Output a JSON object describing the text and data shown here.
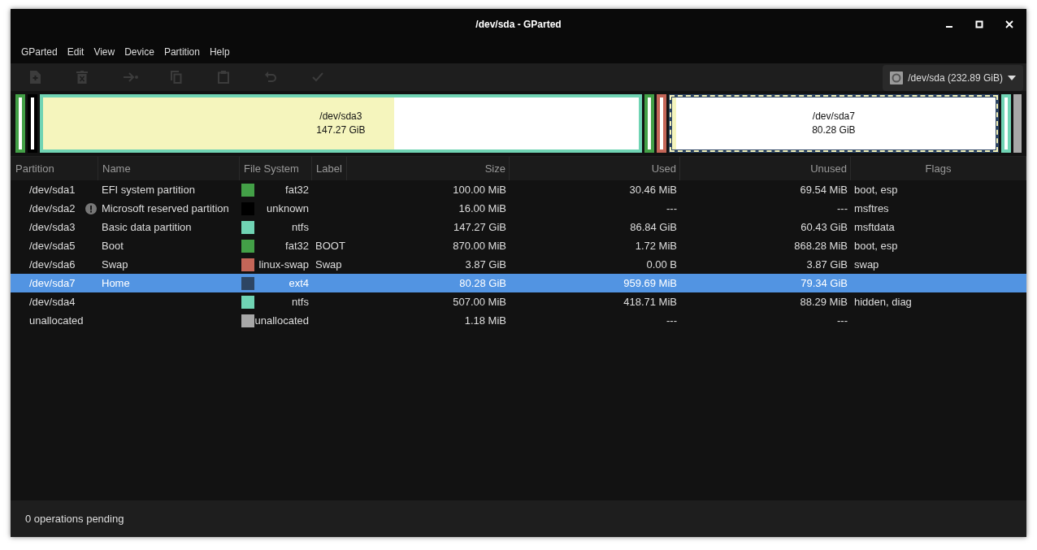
{
  "window": {
    "title": "/dev/sda - GParted"
  },
  "menu": [
    "GParted",
    "Edit",
    "View",
    "Device",
    "Partition",
    "Help"
  ],
  "toolbar": [
    {
      "kind": "new",
      "disabled": true
    },
    {
      "kind": "delete",
      "disabled": true
    },
    {
      "kind": "resize",
      "disabled": true
    },
    {
      "kind": "copy",
      "disabled": true
    },
    {
      "kind": "paste",
      "disabled": true
    },
    {
      "kind": "undo",
      "disabled": true
    },
    {
      "kind": "apply",
      "disabled": true
    }
  ],
  "device": {
    "label": "/dev/sda (232.89 GiB)"
  },
  "map": [
    {
      "kind": "narrow",
      "color": "#43a047",
      "selected": false
    },
    {
      "kind": "narrow",
      "color": "#000000",
      "selected": false
    },
    {
      "kind": "wide",
      "color": "#70d4b4",
      "level": 0.59,
      "name": "/dev/sda3",
      "size": "147.27 GiB",
      "selected": false
    },
    {
      "kind": "narrow",
      "color": "#43a047",
      "selected": false
    },
    {
      "kind": "narrow",
      "color": "#c46658",
      "selected": false
    },
    {
      "kind": "wide",
      "color": "#2d4563",
      "level": 0.012,
      "name": "/dev/sda7",
      "size": "80.28 GiB",
      "selected": true
    },
    {
      "kind": "narrow",
      "color": "#70d4b4",
      "selected": false
    },
    {
      "kind": "unallocated",
      "color": "#a8a8a8",
      "selected": false
    }
  ],
  "table": {
    "columns": [
      "Partition",
      "Name",
      "File System",
      "Label",
      "Size",
      "Used",
      "Unused",
      "Flags"
    ],
    "rows": [
      {
        "partition": "/dev/sda1",
        "warning": false,
        "name": "EFI system partition",
        "color": "#43a047",
        "file_system": "fat32",
        "label": "",
        "size": "100.00 MiB",
        "used": "30.46 MiB",
        "unused": "69.54 MiB",
        "flags": "boot, esp",
        "selected": false
      },
      {
        "partition": "/dev/sda2",
        "warning": true,
        "name": "Microsoft reserved partition",
        "color": "#000000",
        "file_system": "unknown",
        "label": "",
        "size": "16.00 MiB",
        "used": "---",
        "unused": "---",
        "flags": "msftres",
        "selected": false
      },
      {
        "partition": "/dev/sda3",
        "warning": false,
        "name": "Basic data partition",
        "color": "#70d4b4",
        "file_system": "ntfs",
        "label": "",
        "size": "147.27 GiB",
        "used": "86.84 GiB",
        "unused": "60.43 GiB",
        "flags": "msftdata",
        "selected": false
      },
      {
        "partition": "/dev/sda5",
        "warning": false,
        "name": "Boot",
        "color": "#43a047",
        "file_system": "fat32",
        "label": "BOOT",
        "size": "870.00 MiB",
        "used": "1.72 MiB",
        "unused": "868.28 MiB",
        "flags": "boot, esp",
        "selected": false
      },
      {
        "partition": "/dev/sda6",
        "warning": false,
        "name": "Swap",
        "color": "#c46658",
        "file_system": "linux-swap",
        "label": "Swap",
        "size": "3.87 GiB",
        "used": "0.00 B",
        "unused": "3.87 GiB",
        "flags": "swap",
        "selected": false
      },
      {
        "partition": "/dev/sda7",
        "warning": false,
        "name": "Home",
        "color": "#2d4563",
        "file_system": "ext4",
        "label": "",
        "size": "80.28 GiB",
        "used": "959.69 MiB",
        "unused": "79.34 GiB",
        "flags": "",
        "selected": true
      },
      {
        "partition": "/dev/sda4",
        "warning": false,
        "name": "",
        "color": "#70d4b4",
        "file_system": "ntfs",
        "label": "",
        "size": "507.00 MiB",
        "used": "418.71 MiB",
        "unused": "88.29 MiB",
        "flags": "hidden, diag",
        "selected": false
      },
      {
        "partition": "unallocated",
        "warning": false,
        "name": "",
        "color": "#a8a8a8",
        "file_system": "unallocated",
        "label": "",
        "size": "1.18 MiB",
        "used": "---",
        "unused": "---",
        "flags": "",
        "selected": false
      }
    ]
  },
  "status_bar": "0 operations pending"
}
